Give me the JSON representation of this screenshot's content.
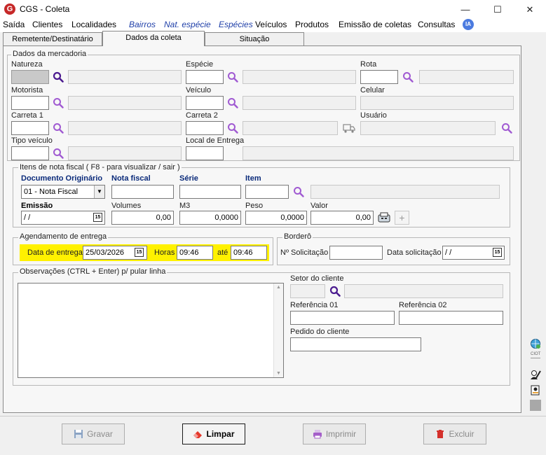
{
  "window": {
    "title": "CGS - Coleta",
    "app_icon_letter": "G",
    "minimize": "—",
    "maximize": "☐",
    "close": "✕"
  },
  "menu": [
    {
      "label": "Saída"
    },
    {
      "label": "Clientes"
    },
    {
      "label": "Localidades"
    },
    {
      "label": "Bairros"
    },
    {
      "label": "Nat. espécie"
    },
    {
      "label": "Espécies"
    },
    {
      "label": "Veículos"
    },
    {
      "label": "Produtos"
    },
    {
      "label": "Emissão de coletas"
    },
    {
      "label": "Consultas"
    }
  ],
  "ia_badge": "IA",
  "tabs": [
    {
      "label": "Remetente/Destinatário"
    },
    {
      "label": "Dados da coleta"
    },
    {
      "label": "Situação"
    }
  ],
  "mercadoria": {
    "legend": "Dados da mercadoria",
    "natureza": "Natureza",
    "especie": "Espécie",
    "rota": "Rota",
    "motorista": "Motorista",
    "veiculo": "Veículo",
    "celular": "Celular",
    "carreta1": "Carreta 1",
    "carreta2": "Carreta 2",
    "usuario": "Usuário",
    "tipo_veiculo": "Tipo veículo",
    "local_entrega": "Local de Entrega"
  },
  "itens": {
    "legend": "Itens de nota fiscal ( F8 - para visualizar / sair )",
    "documento_originario": "Documento Originário",
    "documento_value": "01 - Nota Fiscal",
    "nota_fiscal": "Nota fiscal",
    "serie": "Série",
    "item": "Item",
    "emissao": "Emissão",
    "emissao_value": " /  /",
    "volumes": "Volumes",
    "volumes_value": "0,00",
    "m3": "M3",
    "m3_value": "0,0000",
    "peso": "Peso",
    "peso_value": "0,0000",
    "valor": "Valor",
    "valor_value": "0,00",
    "add_symbol": "+"
  },
  "agendamento": {
    "legend": "Agendamento de entrega",
    "data_label": "Data de entrega",
    "data_value": "25/03/2026",
    "horas_label": "Horas",
    "horas_value": "09:46",
    "ate_label": "até",
    "ate_value": "09:46"
  },
  "bordero": {
    "legend": "Borderô",
    "solicitacao_label": "Nº Solicitação",
    "data_solicitacao_label": "Data solicitação",
    "data_solicitacao_value": " /  /"
  },
  "observacoes": {
    "legend": "Observações (CTRL + Enter) p/ pular linha"
  },
  "cliente": {
    "setor": "Setor do cliente",
    "ref1": "Referência 01",
    "ref2": "Referência 02",
    "pedido": "Pedido do cliente"
  },
  "calendar_glyph": "15",
  "side": {
    "ciot": "CIOT"
  },
  "buttons": {
    "gravar": "Gravar",
    "limpar": "Limpar",
    "imprimir": "Imprimir",
    "excluir": "Excluir"
  }
}
